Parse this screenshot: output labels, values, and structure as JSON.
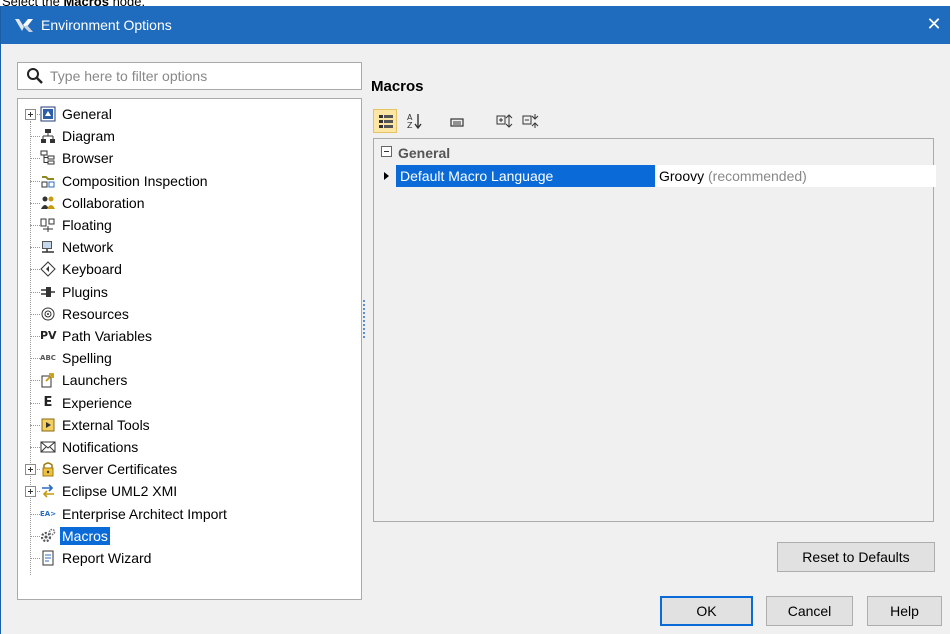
{
  "instruction": {
    "prefix": "Select the ",
    "bold": "Macros",
    "suffix": " node."
  },
  "window": {
    "title": "Environment Options",
    "close_glyph": "✕"
  },
  "filter": {
    "placeholder": "Type here to filter options",
    "value": ""
  },
  "tree": {
    "items": [
      {
        "label": "General",
        "icon": "general-options-icon",
        "expandable": true
      },
      {
        "label": "Diagram",
        "icon": "diagram-icon",
        "expandable": false
      },
      {
        "label": "Browser",
        "icon": "browser-icon",
        "expandable": false
      },
      {
        "label": "Composition Inspection",
        "icon": "composition-inspection-icon",
        "expandable": false
      },
      {
        "label": "Collaboration",
        "icon": "collaboration-icon",
        "expandable": false
      },
      {
        "label": "Floating",
        "icon": "floating-icon",
        "expandable": false
      },
      {
        "label": "Network",
        "icon": "network-icon",
        "expandable": false
      },
      {
        "label": "Keyboard",
        "icon": "keyboard-icon",
        "expandable": false
      },
      {
        "label": "Plugins",
        "icon": "plugins-icon",
        "expandable": false
      },
      {
        "label": "Resources",
        "icon": "resources-icon",
        "expandable": false
      },
      {
        "label": "Path Variables",
        "icon": "path-variables-icon",
        "icon_text": "PV",
        "expandable": false
      },
      {
        "label": "Spelling",
        "icon": "spelling-icon",
        "icon_text": "ABC",
        "expandable": false
      },
      {
        "label": "Launchers",
        "icon": "launchers-icon",
        "expandable": false
      },
      {
        "label": "Experience",
        "icon": "experience-icon",
        "icon_text": "E",
        "expandable": false
      },
      {
        "label": "External Tools",
        "icon": "external-tools-icon",
        "expandable": false
      },
      {
        "label": "Notifications",
        "icon": "notifications-icon",
        "expandable": false
      },
      {
        "label": "Server Certificates",
        "icon": "lock-icon",
        "expandable": true
      },
      {
        "label": "Eclipse UML2 XMI",
        "icon": "eclipse-uml2-xmi-icon",
        "expandable": true
      },
      {
        "label": "Enterprise Architect Import",
        "icon": "enterprise-architect-icon",
        "icon_text": "EA>",
        "expandable": false
      },
      {
        "label": "Macros",
        "icon": "macros-icon",
        "expandable": false,
        "selected": true
      },
      {
        "label": "Report Wizard",
        "icon": "report-wizard-icon",
        "expandable": false
      }
    ]
  },
  "panel": {
    "title": "Macros",
    "category": "General",
    "property": {
      "name": "Default Macro Language",
      "value": "Groovy",
      "hint": " (recommended)"
    }
  },
  "buttons": {
    "reset": "Reset to Defaults",
    "ok": "OK",
    "cancel": "Cancel",
    "help": "Help"
  },
  "colors": {
    "titlebar": "#1f6bbd",
    "selection": "#0a6bd8",
    "toolbar_active": "#fbe6a4"
  }
}
